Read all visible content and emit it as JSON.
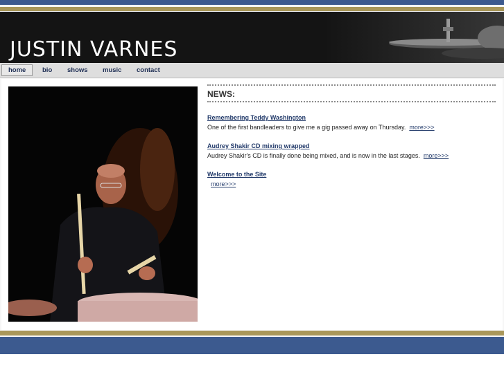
{
  "header": {
    "title": "JUSTIN VARNES"
  },
  "nav": {
    "items": [
      {
        "label": "home",
        "active": true
      },
      {
        "label": "bio"
      },
      {
        "label": "shows"
      },
      {
        "label": "music"
      },
      {
        "label": "contact"
      }
    ]
  },
  "news": {
    "title": "NEWS:",
    "items": [
      {
        "headline": "Remembering Teddy Washington",
        "body": "One of the first bandleaders to give me a gig passed away on Thursday.",
        "more": "more>>>"
      },
      {
        "headline": "Audrey Shakir CD mixing wrapped",
        "body": "Audrey Shakir's CD is finally done being mixed, and is now in the last stages.",
        "more": "more>>>"
      },
      {
        "headline": "Welcome to the Site",
        "body": "",
        "more": "more>>>"
      }
    ]
  },
  "colors": {
    "nav_blue": "#3c5a8f",
    "gold": "#a9975a",
    "link": "#223a6a"
  }
}
